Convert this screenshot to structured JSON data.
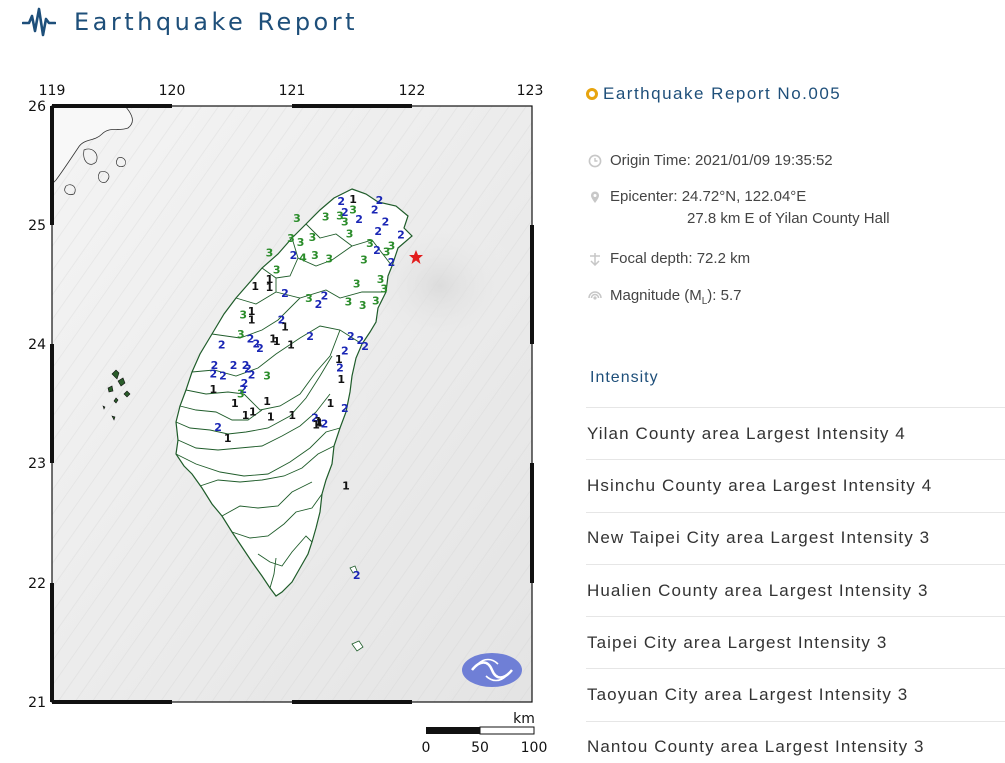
{
  "header": {
    "title": "Earthquake Report",
    "logo_icon": "seismograph-icon"
  },
  "map": {
    "lon_labels": [
      "119",
      "120",
      "121",
      "122",
      "123"
    ],
    "lat_labels": [
      "26",
      "25",
      "24",
      "23",
      "22",
      "21"
    ],
    "scale_unit": "km",
    "scale_ticks": [
      "0",
      "50",
      "100"
    ],
    "epicenter_marker": "star-icon",
    "intensity_colors": {
      "1": "#111111",
      "2": "#1a26b5",
      "3": "#2a8c2a",
      "4": "#2a8c2a"
    },
    "stations": [
      {
        "v": "1",
        "lat": 25.19,
        "lon": 121.52
      },
      {
        "v": "2",
        "lat": 25.17,
        "lon": 121.42
      },
      {
        "v": "2",
        "lat": 25.18,
        "lon": 121.74
      },
      {
        "v": "2",
        "lat": 25.1,
        "lon": 121.7
      },
      {
        "v": "3",
        "lat": 25.1,
        "lon": 121.52
      },
      {
        "v": "2",
        "lat": 25.08,
        "lon": 121.45
      },
      {
        "v": "3",
        "lat": 25.05,
        "lon": 121.41
      },
      {
        "v": "3",
        "lat": 25.04,
        "lon": 121.29
      },
      {
        "v": "3",
        "lat": 25.03,
        "lon": 121.05
      },
      {
        "v": "2",
        "lat": 25.02,
        "lon": 121.57
      },
      {
        "v": "2",
        "lat": 25.0,
        "lon": 121.79
      },
      {
        "v": "3",
        "lat": 25.0,
        "lon": 121.45
      },
      {
        "v": "2",
        "lat": 24.92,
        "lon": 121.73
      },
      {
        "v": "2",
        "lat": 24.89,
        "lon": 121.92
      },
      {
        "v": "3",
        "lat": 24.9,
        "lon": 121.49
      },
      {
        "v": "3",
        "lat": 24.87,
        "lon": 121.18
      },
      {
        "v": "3",
        "lat": 24.86,
        "lon": 121.0
      },
      {
        "v": "3",
        "lat": 24.83,
        "lon": 121.08
      },
      {
        "v": "3",
        "lat": 24.82,
        "lon": 121.66
      },
      {
        "v": "3",
        "lat": 24.8,
        "lon": 121.84
      },
      {
        "v": "3",
        "lat": 24.75,
        "lon": 121.8
      },
      {
        "v": "2",
        "lat": 24.76,
        "lon": 121.72
      },
      {
        "v": "3",
        "lat": 24.74,
        "lon": 120.82
      },
      {
        "v": "3",
        "lat": 24.72,
        "lon": 121.2
      },
      {
        "v": "2",
        "lat": 24.72,
        "lon": 121.02
      },
      {
        "v": "4",
        "lat": 24.7,
        "lon": 121.1
      },
      {
        "v": "3",
        "lat": 24.69,
        "lon": 121.32
      },
      {
        "v": "3",
        "lat": 24.68,
        "lon": 121.61
      },
      {
        "v": "2",
        "lat": 24.66,
        "lon": 121.84
      },
      {
        "v": "3",
        "lat": 24.6,
        "lon": 120.88
      },
      {
        "v": "1",
        "lat": 24.52,
        "lon": 120.82
      },
      {
        "v": "3",
        "lat": 24.52,
        "lon": 121.75
      },
      {
        "v": "3",
        "lat": 24.48,
        "lon": 121.55
      },
      {
        "v": "1",
        "lat": 24.46,
        "lon": 120.7
      },
      {
        "v": "1",
        "lat": 24.45,
        "lon": 120.82
      },
      {
        "v": "3",
        "lat": 24.44,
        "lon": 121.78
      },
      {
        "v": "2",
        "lat": 24.4,
        "lon": 120.95
      },
      {
        "v": "3",
        "lat": 24.36,
        "lon": 121.15
      },
      {
        "v": "2",
        "lat": 24.38,
        "lon": 121.28
      },
      {
        "v": "3",
        "lat": 24.33,
        "lon": 121.48
      },
      {
        "v": "3",
        "lat": 24.34,
        "lon": 121.71
      },
      {
        "v": "2",
        "lat": 24.31,
        "lon": 121.23
      },
      {
        "v": "3",
        "lat": 24.3,
        "lon": 121.6
      },
      {
        "v": "1",
        "lat": 24.25,
        "lon": 120.67
      },
      {
        "v": "3",
        "lat": 24.22,
        "lon": 120.6
      },
      {
        "v": "1",
        "lat": 24.18,
        "lon": 120.67
      },
      {
        "v": "2",
        "lat": 24.18,
        "lon": 120.92
      },
      {
        "v": "1",
        "lat": 24.12,
        "lon": 120.95
      },
      {
        "v": "2",
        "lat": 24.04,
        "lon": 121.16
      },
      {
        "v": "3",
        "lat": 24.06,
        "lon": 120.58
      },
      {
        "v": "2",
        "lat": 24.02,
        "lon": 120.66
      },
      {
        "v": "1",
        "lat": 24.02,
        "lon": 120.85
      },
      {
        "v": "1",
        "lat": 24.0,
        "lon": 120.88
      },
      {
        "v": "2",
        "lat": 24.04,
        "lon": 121.5
      },
      {
        "v": "2",
        "lat": 24.01,
        "lon": 121.58
      },
      {
        "v": "1",
        "lat": 23.97,
        "lon": 121.0
      },
      {
        "v": "2",
        "lat": 23.96,
        "lon": 121.62
      },
      {
        "v": "2",
        "lat": 23.98,
        "lon": 120.71
      },
      {
        "v": "2",
        "lat": 23.94,
        "lon": 120.74
      },
      {
        "v": "2",
        "lat": 23.97,
        "lon": 120.42
      },
      {
        "v": "2",
        "lat": 23.92,
        "lon": 121.45
      },
      {
        "v": "1",
        "lat": 23.85,
        "lon": 121.4
      },
      {
        "v": "2",
        "lat": 23.78,
        "lon": 121.41
      },
      {
        "v": "2",
        "lat": 23.8,
        "lon": 120.36
      },
      {
        "v": "2",
        "lat": 23.8,
        "lon": 120.52
      },
      {
        "v": "2",
        "lat": 23.8,
        "lon": 120.62
      },
      {
        "v": "2",
        "lat": 23.77,
        "lon": 120.64
      },
      {
        "v": "2",
        "lat": 23.73,
        "lon": 120.35
      },
      {
        "v": "2",
        "lat": 23.72,
        "lon": 120.67
      },
      {
        "v": "3",
        "lat": 23.71,
        "lon": 120.8
      },
      {
        "v": "1",
        "lat": 23.68,
        "lon": 121.42
      },
      {
        "v": "2",
        "lat": 23.71,
        "lon": 120.43
      },
      {
        "v": "2",
        "lat": 23.65,
        "lon": 120.61
      },
      {
        "v": "2",
        "lat": 23.6,
        "lon": 120.6
      },
      {
        "v": "3",
        "lat": 23.56,
        "lon": 120.58
      },
      {
        "v": "1",
        "lat": 23.6,
        "lon": 120.35
      },
      {
        "v": "1",
        "lat": 23.48,
        "lon": 121.33
      },
      {
        "v": "2",
        "lat": 23.44,
        "lon": 121.45
      },
      {
        "v": "1",
        "lat": 23.5,
        "lon": 120.8
      },
      {
        "v": "1",
        "lat": 23.48,
        "lon": 120.53
      },
      {
        "v": "1",
        "lat": 23.32,
        "lon": 121.24
      },
      {
        "v": "2",
        "lat": 23.28,
        "lon": 120.39
      },
      {
        "v": "1",
        "lat": 23.38,
        "lon": 120.62
      },
      {
        "v": "1",
        "lat": 23.41,
        "lon": 120.68
      },
      {
        "v": "1",
        "lat": 23.37,
        "lon": 120.83
      },
      {
        "v": "1",
        "lat": 23.38,
        "lon": 121.01
      },
      {
        "v": "2",
        "lat": 23.36,
        "lon": 121.2
      },
      {
        "v": "1",
        "lat": 23.33,
        "lon": 121.23
      },
      {
        "v": "1",
        "lat": 23.3,
        "lon": 121.21
      },
      {
        "v": "2",
        "lat": 23.31,
        "lon": 121.28
      },
      {
        "v": "1",
        "lat": 23.19,
        "lon": 120.47
      },
      {
        "v": "1",
        "lat": 22.79,
        "lon": 121.46
      },
      {
        "v": "2",
        "lat": 22.04,
        "lon": 121.55
      }
    ]
  },
  "report": {
    "title": "Earthquake Report No.005",
    "origin_time_label": "Origin Time: 2021/01/09 19:35:52",
    "epicenter_label": "Epicenter: 24.72°N, 122.04°E",
    "epicenter_location": "27.8 km E of Yilan County Hall",
    "focal_depth_label": "Focal depth: 72.2 km",
    "magnitude_prefix": "Magnitude (M",
    "magnitude_sub": "L",
    "magnitude_suffix": "): 5.7",
    "icons": [
      "clock-icon",
      "map-pin-icon",
      "depth-icon",
      "magnitude-icon"
    ]
  },
  "intensity": {
    "heading": "Intensity",
    "items": [
      "Yilan County area Largest Intensity 4",
      "Hsinchu County area Largest Intensity 4",
      "New Taipei City area Largest Intensity 3",
      "Hualien County area Largest Intensity 3",
      "Taipei City area Largest Intensity 3",
      "Taoyuan City area Largest Intensity 3",
      "Nantou County area Largest Intensity 3"
    ]
  }
}
